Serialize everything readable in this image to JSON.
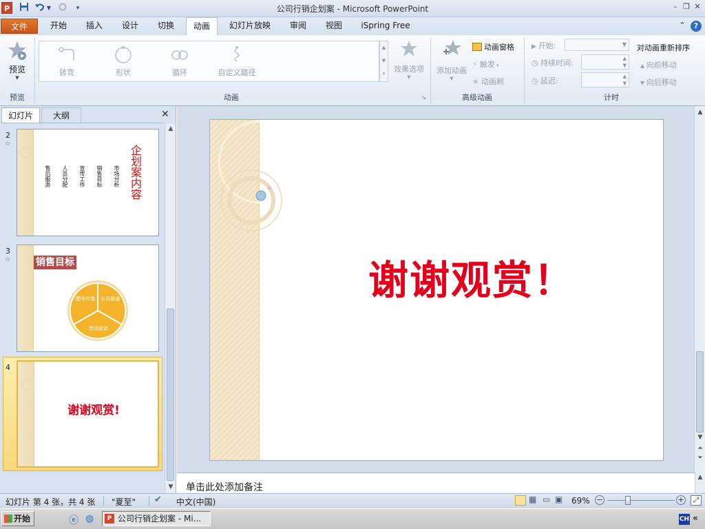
{
  "window": {
    "title": "公司行销企划案 - Microsoft PowerPoint",
    "app_icon": "P",
    "quick_access": {
      "save_icon": "save-icon",
      "undo_icon": "undo-icon",
      "redo_icon": "redo-icon",
      "customize_icon": "customize-icon"
    },
    "controls": {
      "minimize": "–",
      "restore": "❐",
      "close": "✕"
    }
  },
  "tabs": {
    "file": "文件",
    "items": [
      "开始",
      "插入",
      "设计",
      "切换",
      "动画",
      "幻灯片放映",
      "审阅",
      "视图",
      "iSpring Free"
    ],
    "active": "动画",
    "help_icons": [
      "⌃",
      "?"
    ]
  },
  "ribbon": {
    "preview": {
      "button": "预览",
      "group_label": "预览"
    },
    "animation_gallery": {
      "items": [
        "转弯",
        "形状",
        "循环",
        "自定义路径"
      ],
      "group_label": "动画"
    },
    "effect_options": "效果选项",
    "advanced": {
      "add_animation": "添加动画",
      "animation_pane": "动画窗格",
      "trigger": "触发",
      "animation_painter": "动画刷",
      "group_label": "高级动画"
    },
    "timing": {
      "start_label": "开始:",
      "duration_label": "持续时间:",
      "delay_label": "延迟:",
      "group_label": "计时"
    },
    "reorder": {
      "title": "对动画重新排序",
      "move_earlier": "向前移动",
      "move_later": "向后移动"
    }
  },
  "left_pane": {
    "tab_slides": "幻灯片",
    "tab_outline": "大纲",
    "close": "✕",
    "thumbnails": [
      {
        "number": "2",
        "title": "企划案内容",
        "bullets": [
          "售后服务",
          "人员分配",
          "宣传工作",
          "销售目标",
          "市场分析"
        ]
      },
      {
        "number": "3",
        "title": "销售目标",
        "segments": [
          "图书市场",
          "公司普通",
          "市场营销"
        ]
      },
      {
        "number": "4",
        "title": "谢谢观赏!",
        "selected": true
      }
    ]
  },
  "slide": {
    "text": "谢谢观赏！",
    "color": "#e3001b"
  },
  "notes": {
    "placeholder": "单击此处添加备注"
  },
  "status": {
    "slide_info": "幻灯片 第 4 张，共 4 张",
    "theme": "\"夏至\"",
    "language": "中文(中国)",
    "zoom": "69%"
  },
  "taskbar": {
    "start": "开始",
    "window_item": "公司行销企划案 - Mi...",
    "ime": "CH",
    "expand": "«"
  }
}
